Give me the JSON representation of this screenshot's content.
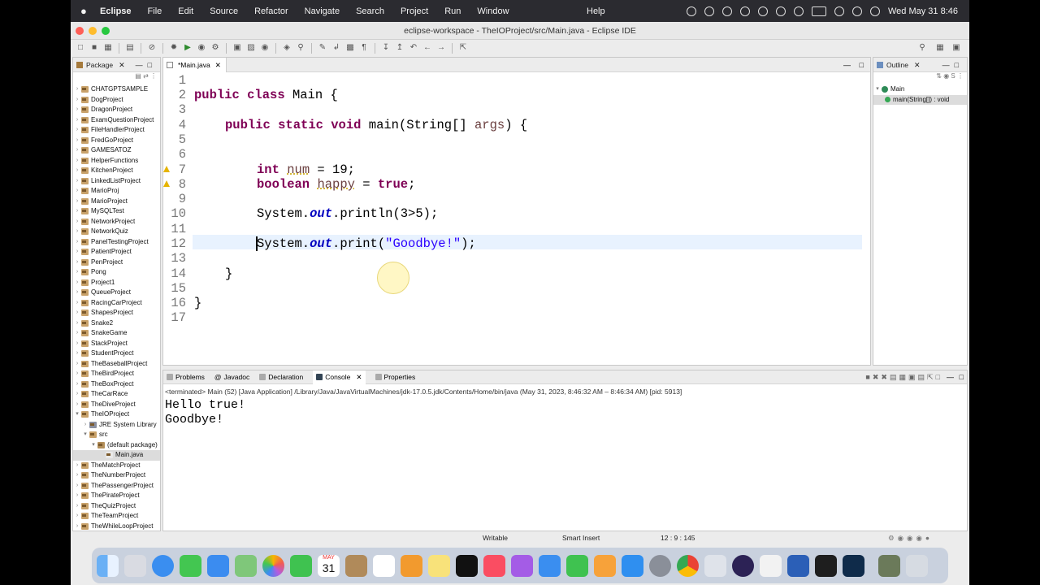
{
  "menubar": {
    "app": "Eclipse",
    "items": [
      "File",
      "Edit",
      "Source",
      "Refactor",
      "Navigate",
      "Search",
      "Project",
      "Run",
      "Window"
    ],
    "help": "Help",
    "datetime": "Wed May 31  8:46"
  },
  "window": {
    "title": "eclipse-workspace - TheIOProject/src/Main.java - Eclipse IDE"
  },
  "package_explorer": {
    "tab_label": "Package",
    "projects": [
      "CHATGPTSAMPLE",
      "DogProject",
      "DragonProject",
      "ExamQuestionProject",
      "FileHandlerProject",
      "FredGoProject",
      "GAMESATOZ",
      "HelperFunctions",
      "KitchenProject",
      "LinkedListProject",
      "MarioProj",
      "MarioProject",
      "MySQLTest",
      "NetworkProject",
      "NetworkQuiz",
      "PanelTestingProject",
      "PatientProject",
      "PenProject",
      "Pong",
      "Project1",
      "QueueProject",
      "RacingCarProject",
      "ShapesProject",
      "Snake2",
      "SnakeGame",
      "StackProject",
      "StudentProject",
      "TheBaseballProject",
      "TheBirdProject",
      "TheBoxProject",
      "TheCarRace",
      "TheDiveProject",
      "TheIOProject"
    ],
    "expanded": [
      "JRE System Library",
      "src",
      "(default package)",
      "Main.java"
    ],
    "projects_after": [
      "TheMatchProject",
      "TheNumberProject",
      "ThePassengerProject",
      "ThePirateProject",
      "TheQuizProject",
      "TheTeamProject",
      "TheWhileLoopProject"
    ]
  },
  "editor": {
    "tab_label": "*Main.java",
    "line_numbers": [
      "1",
      "2",
      "3",
      "4",
      "5",
      "6",
      "7",
      "8",
      "9",
      "10",
      "11",
      "12",
      "13",
      "14",
      "15",
      "16",
      "17"
    ],
    "lines": {
      "l2_kw1": "public",
      "l2_kw2": "class",
      "l2_rest": " Main {",
      "l4_kw1": "public",
      "l4_kw2": "static",
      "l4_kw3": "void",
      "l4_rest1": " main(String[] ",
      "l4_var": "args",
      "l4_rest2": ") {",
      "l7_kw": "int",
      "l7_var": "num",
      "l7_rest": " = 19;",
      "l8_kw": "boolean",
      "l8_var": "happy",
      "l8_eq": " = ",
      "l8_kw2": "true",
      "l8_semi": ";",
      "l10_sys": "System.",
      "l10_out": "out",
      "l10_rest": ".println(3>5);",
      "l12_sys": "System.",
      "l12_out": "out",
      "l12_rest1": ".print(",
      "l12_str": "\"Goodbye!\"",
      "l12_rest2": ");",
      "l14": "}",
      "l16": "}"
    }
  },
  "outline": {
    "tab_label": "Outline",
    "class": "Main",
    "method": "main(String[]) : void"
  },
  "console": {
    "tabs": [
      "Problems",
      "Javadoc",
      "Declaration",
      "Console",
      "Properties"
    ],
    "terminated": "<terminated> Main (52) [Java Application] /Library/Java/JavaVirtualMachines/jdk-17.0.5.jdk/Contents/Home/bin/java  (May 31, 2023, 8:46:32 AM – 8:46:34 AM) [pid: 5913]",
    "output": [
      "Hello true!",
      "Goodbye!"
    ]
  },
  "statusbar": {
    "writable": "Writable",
    "insert_mode": "Smart Insert",
    "position": "12 : 9 : 145"
  },
  "dock": {
    "calendar_month": "MAY",
    "calendar_day": "31"
  }
}
